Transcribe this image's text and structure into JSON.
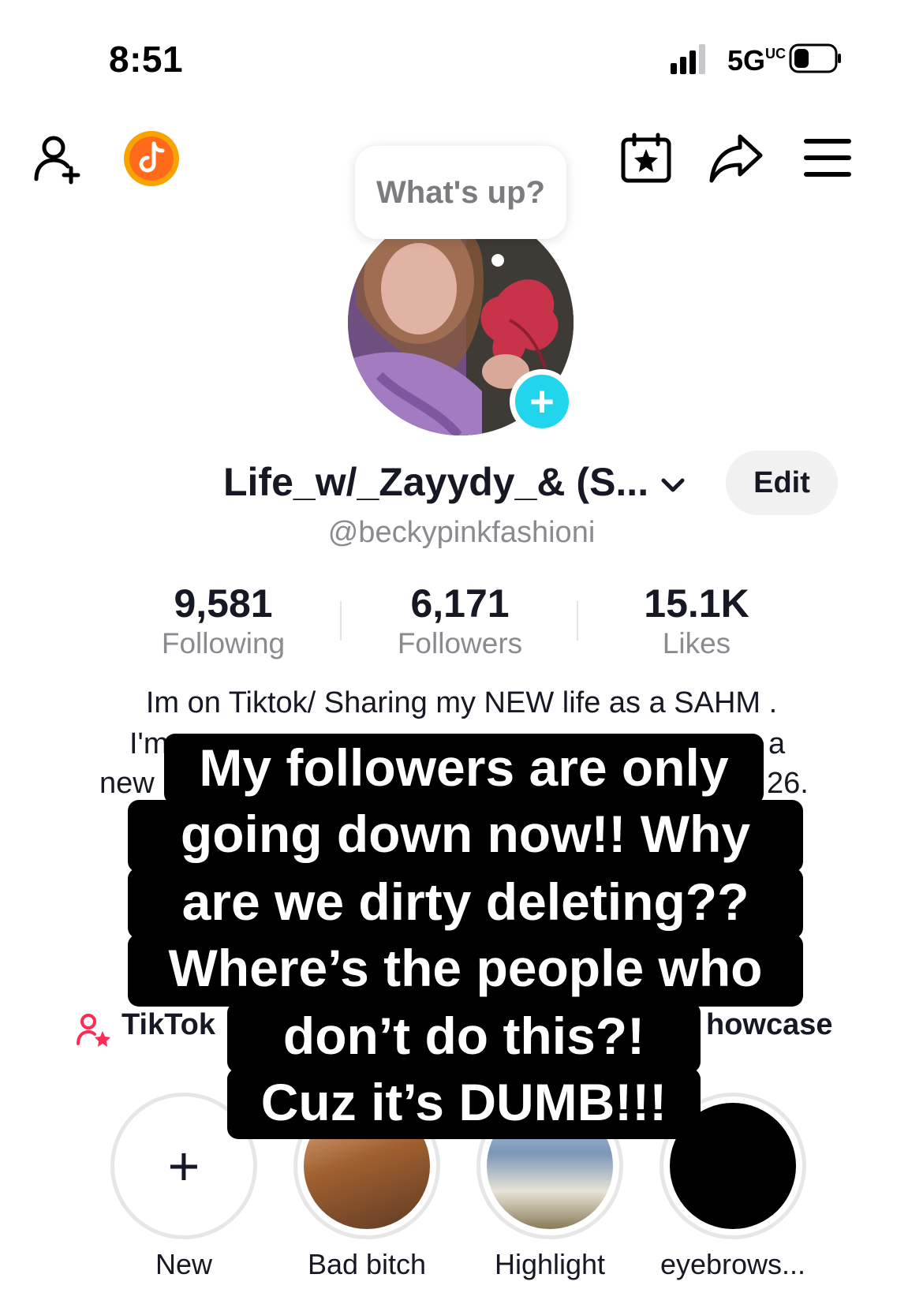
{
  "status_bar": {
    "time": "8:51",
    "network": "5G",
    "network_suffix": "UC"
  },
  "top_bar": {
    "add_friend_icon": "person-plus-icon",
    "tiktok_coin_icon": "tiktok-coin-icon",
    "calendar_icon": "calendar-star-icon",
    "share_icon": "share-arrow-icon",
    "menu_icon": "hamburger-menu-icon"
  },
  "bubble": {
    "text": "What's up?"
  },
  "profile": {
    "display_name": "Life_w/_Zayydy_& (S...",
    "username": "@beckypinkfashioni",
    "edit_label": "Edit"
  },
  "stats": [
    {
      "value": "9,581",
      "label": "Following"
    },
    {
      "value": "6,171",
      "label": "Followers"
    },
    {
      "value": "15.1K",
      "label": "Likes"
    }
  ],
  "bio": {
    "line1": "Im on Tiktok/ Sharing my NEW life as a SAHM .",
    "line2_left": "I'm",
    "line2_right": "a",
    "line3_left": "new",
    "line3_right": "26."
  },
  "overlay_caption": {
    "line1": "My followers are only",
    "line2": "going down now!!  Why",
    "line3": "are we dirty deleting??",
    "line4": "Where’s the people who",
    "line5": "don’t do this?!",
    "line6": "Cuz it’s DUMB!!!"
  },
  "tiktok_row": {
    "left_label": "TikTok",
    "right_label": "howcase"
  },
  "highlights": [
    {
      "label": "New"
    },
    {
      "label": "Bad bitch"
    },
    {
      "label": "Highlight"
    },
    {
      "label": "eyebrows..."
    }
  ],
  "colors": {
    "accent_cyan": "#20d5ec",
    "brand_pink": "#fe2c55",
    "text_primary": "#161823",
    "text_secondary": "#8a8b91"
  }
}
